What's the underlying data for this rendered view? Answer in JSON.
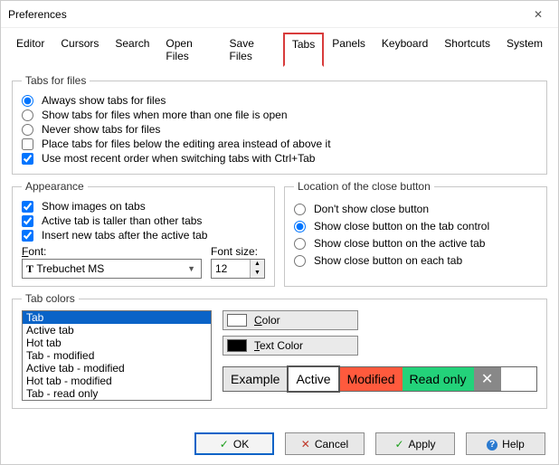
{
  "window": {
    "title": "Preferences"
  },
  "tabs": [
    "Editor",
    "Cursors",
    "Search",
    "Open Files",
    "Save Files",
    "Tabs",
    "Panels",
    "Keyboard",
    "Shortcuts",
    "System"
  ],
  "active_tab_index": 5,
  "tabs_for_files": {
    "legend": "Tabs for files",
    "r1": "Always show tabs for files",
    "r2": "Show tabs for files when more than one file is open",
    "r3": "Never show tabs for files",
    "c1": "Place tabs for files below the editing area instead of above it",
    "c2": "Use most recent order when switching tabs with Ctrl+Tab"
  },
  "appearance": {
    "legend": "Appearance",
    "c1": "Show images on tabs",
    "c2": "Active tab is taller than other tabs",
    "c3": "Insert new tabs after the active tab",
    "font_label": "Font:",
    "font_value": "Trebuchet MS",
    "fontsize_label": "Font size:",
    "fontsize_value": "12"
  },
  "closebtn": {
    "legend": "Location of the close button",
    "r1": "Don't show close button",
    "r2": "Show close button on the tab control",
    "r3": "Show close button on the active tab",
    "r4": "Show close button on each tab"
  },
  "tabcolors": {
    "legend": "Tab colors",
    "items": [
      "Tab",
      "Active tab",
      "Hot tab",
      "Tab - modified",
      "Active tab - modified",
      "Hot tab - modified",
      "Tab - read only"
    ],
    "selected_index": 0,
    "color_btn": "Color",
    "textcolor_btn": "Text Color",
    "color_sw": "#ffffff",
    "textcolor_sw": "#000000",
    "preview": {
      "example": "Example",
      "active": "Active",
      "modified": "Modified",
      "readonly": "Read only"
    }
  },
  "buttons": {
    "ok": "OK",
    "cancel": "Cancel",
    "apply": "Apply",
    "help": "Help"
  }
}
